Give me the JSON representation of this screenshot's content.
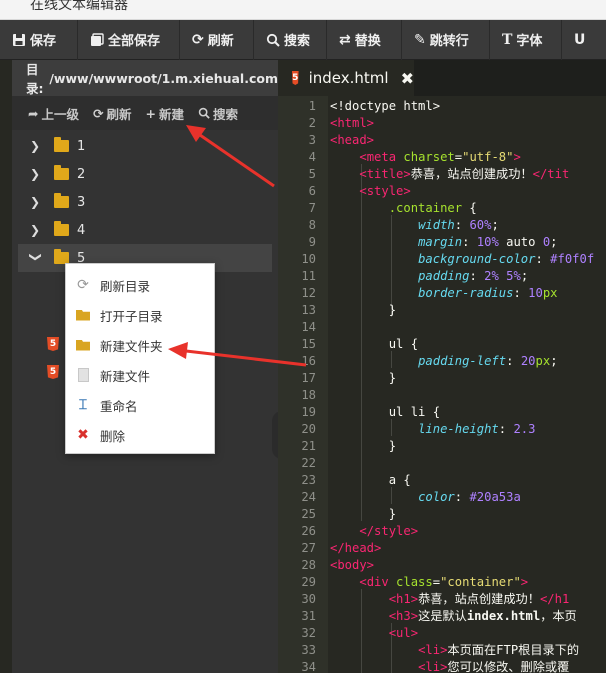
{
  "window": {
    "title": "在线文本编辑器"
  },
  "toolbar": [
    {
      "label": "保存",
      "icon": "save-icon"
    },
    {
      "label": "全部保存",
      "icon": "save-all-icon"
    },
    {
      "label": "刷新",
      "icon": "refresh-icon"
    },
    {
      "label": "搜索",
      "icon": "search-icon"
    },
    {
      "label": "替换",
      "icon": "replace-icon"
    },
    {
      "label": "跳转行",
      "icon": "jump-icon"
    },
    {
      "label": "字体",
      "icon": "font-icon"
    }
  ],
  "sidebar": {
    "path_label": "目录:",
    "path_value": "/www/wwwroot/1.m.xiehual.com",
    "actions": [
      {
        "label": "上一级",
        "icon": "up-icon"
      },
      {
        "label": "刷新",
        "icon": "refresh-icon"
      },
      {
        "label": "新建",
        "icon": "plus-icon"
      },
      {
        "label": "搜索",
        "icon": "search-icon"
      }
    ],
    "tree": [
      "1",
      "2",
      "3",
      "4",
      "5"
    ]
  },
  "context_menu": [
    {
      "label": "刷新目录",
      "icon": "refresh-icon",
      "color": "#999999"
    },
    {
      "label": "打开子目录",
      "icon": "folder-open-icon",
      "color": "#d9a521"
    },
    {
      "label": "新建文件夹",
      "icon": "folder-icon",
      "color": "#d9a521"
    },
    {
      "label": "新建文件",
      "icon": "file-icon",
      "color": "#cccccc"
    },
    {
      "label": "重命名",
      "icon": "rename-icon",
      "color": "#3a78b5"
    },
    {
      "label": "删除",
      "icon": "delete-icon",
      "color": "#d9302c"
    }
  ],
  "editor": {
    "tab_label": "index.html",
    "lines": [
      [
        [
          "t-plain",
          "<!doctype html>"
        ]
      ],
      [
        [
          "t-tag",
          "<html>"
        ]
      ],
      [
        [
          "t-tag",
          "<head>"
        ]
      ],
      [
        [
          "t-plain",
          "    "
        ],
        [
          "t-tag",
          "<meta "
        ],
        [
          "t-attr",
          "charset"
        ],
        [
          "t-plain",
          "="
        ],
        [
          "t-str",
          "\"utf-8\""
        ],
        [
          "t-tag",
          ">"
        ]
      ],
      [
        [
          "t-plain",
          "    "
        ],
        [
          "t-tag",
          "<title>"
        ],
        [
          "t-plain",
          "恭喜，站点创建成功！"
        ],
        [
          "t-tag",
          "</tit"
        ]
      ],
      [
        [
          "t-plain",
          "    "
        ],
        [
          "t-tag",
          "<style>"
        ]
      ],
      [
        [
          "t-plain",
          "        "
        ],
        [
          "t-sel",
          ".container"
        ],
        [
          "t-plain",
          " {"
        ]
      ],
      [
        [
          "t-plain",
          "            "
        ],
        [
          "t-prop",
          "width"
        ],
        [
          "t-plain",
          ": "
        ],
        [
          "t-num",
          "60%"
        ],
        [
          "t-plain",
          ";"
        ]
      ],
      [
        [
          "t-plain",
          "            "
        ],
        [
          "t-prop",
          "margin"
        ],
        [
          "t-plain",
          ": "
        ],
        [
          "t-num",
          "10%"
        ],
        [
          "t-plain",
          " auto "
        ],
        [
          "t-num",
          "0"
        ],
        [
          "t-plain",
          ";"
        ]
      ],
      [
        [
          "t-plain",
          "            "
        ],
        [
          "t-prop",
          "background-color"
        ],
        [
          "t-plain",
          ": "
        ],
        [
          "t-num",
          "#f0f0f"
        ]
      ],
      [
        [
          "t-plain",
          "            "
        ],
        [
          "t-prop",
          "padding"
        ],
        [
          "t-plain",
          ": "
        ],
        [
          "t-num",
          "2%"
        ],
        [
          "t-plain",
          " "
        ],
        [
          "t-num",
          "5%"
        ],
        [
          "t-plain",
          ";"
        ]
      ],
      [
        [
          "t-plain",
          "            "
        ],
        [
          "t-prop",
          "border-radius"
        ],
        [
          "t-plain",
          ": "
        ],
        [
          "t-num",
          "10"
        ],
        [
          "t-attr",
          "px"
        ]
      ],
      [
        [
          "t-plain",
          "        }"
        ]
      ],
      [
        [
          "t-plain",
          ""
        ]
      ],
      [
        [
          "t-plain",
          "        ul {"
        ]
      ],
      [
        [
          "t-plain",
          "            "
        ],
        [
          "t-prop",
          "padding-left"
        ],
        [
          "t-plain",
          ": "
        ],
        [
          "t-num",
          "20"
        ],
        [
          "t-attr",
          "px"
        ],
        [
          "t-plain",
          ";"
        ]
      ],
      [
        [
          "t-plain",
          "        }"
        ]
      ],
      [
        [
          "t-plain",
          ""
        ]
      ],
      [
        [
          "t-plain",
          "        ul li {"
        ]
      ],
      [
        [
          "t-plain",
          "            "
        ],
        [
          "t-prop",
          "line-height"
        ],
        [
          "t-plain",
          ": "
        ],
        [
          "t-num",
          "2.3"
        ]
      ],
      [
        [
          "t-plain",
          "        }"
        ]
      ],
      [
        [
          "t-plain",
          ""
        ]
      ],
      [
        [
          "t-plain",
          "        a {"
        ]
      ],
      [
        [
          "t-plain",
          "            "
        ],
        [
          "t-prop",
          "color"
        ],
        [
          "t-plain",
          ": "
        ],
        [
          "t-num",
          "#20a53a"
        ]
      ],
      [
        [
          "t-plain",
          "        }"
        ]
      ],
      [
        [
          "t-plain",
          "    "
        ],
        [
          "t-tag",
          "</style>"
        ]
      ],
      [
        [
          "t-tag",
          "</head>"
        ]
      ],
      [
        [
          "t-tag",
          "<body>"
        ]
      ],
      [
        [
          "t-plain",
          "    "
        ],
        [
          "t-tag",
          "<div "
        ],
        [
          "t-attr",
          "class"
        ],
        [
          "t-plain",
          "="
        ],
        [
          "t-str",
          "\"container\""
        ],
        [
          "t-tag",
          ">"
        ]
      ],
      [
        [
          "t-plain",
          "        "
        ],
        [
          "t-tag",
          "<h1>"
        ],
        [
          "t-plain",
          "恭喜，站点创建成功！"
        ],
        [
          "t-tag",
          "</h1"
        ]
      ],
      [
        [
          "t-plain",
          "        "
        ],
        [
          "t-tag",
          "<h3>"
        ],
        [
          "t-plain",
          "这是默认"
        ],
        [
          "t-bold",
          "index.html"
        ],
        [
          "t-plain",
          "，本页"
        ]
      ],
      [
        [
          "t-plain",
          "        "
        ],
        [
          "t-tag",
          "<ul>"
        ]
      ],
      [
        [
          "t-plain",
          "            "
        ],
        [
          "t-tag",
          "<li>"
        ],
        [
          "t-plain",
          "本页面在FTP根目录下的"
        ]
      ],
      [
        [
          "t-plain",
          "            "
        ],
        [
          "t-tag",
          "<li>"
        ],
        [
          "t-plain",
          "您可以修改、删除或覆"
        ]
      ]
    ]
  }
}
